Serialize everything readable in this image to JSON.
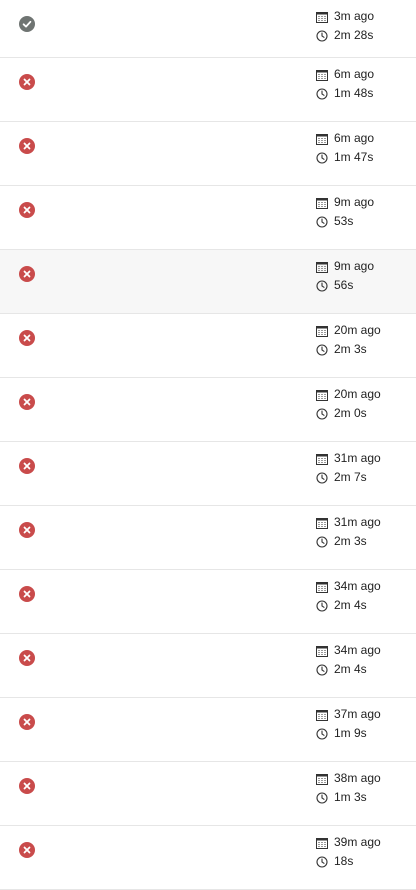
{
  "colors": {
    "success": "#6f7472",
    "failed": "#c94b4b"
  },
  "runs": [
    {
      "status": "success",
      "status_icon": "check-circle-icon",
      "started": "3m ago",
      "duration": "2m 28s"
    },
    {
      "status": "failed",
      "status_icon": "x-circle-icon",
      "started": "6m ago",
      "duration": "1m 48s"
    },
    {
      "status": "failed",
      "status_icon": "x-circle-icon",
      "started": "6m ago",
      "duration": "1m 47s"
    },
    {
      "status": "failed",
      "status_icon": "x-circle-icon",
      "started": "9m ago",
      "duration": "53s"
    },
    {
      "status": "failed",
      "status_icon": "x-circle-icon",
      "started": "9m ago",
      "duration": "56s"
    },
    {
      "status": "failed",
      "status_icon": "x-circle-icon",
      "started": "20m ago",
      "duration": "2m 3s"
    },
    {
      "status": "failed",
      "status_icon": "x-circle-icon",
      "started": "20m ago",
      "duration": "2m 0s"
    },
    {
      "status": "failed",
      "status_icon": "x-circle-icon",
      "started": "31m ago",
      "duration": "2m 7s"
    },
    {
      "status": "failed",
      "status_icon": "x-circle-icon",
      "started": "31m ago",
      "duration": "2m 3s"
    },
    {
      "status": "failed",
      "status_icon": "x-circle-icon",
      "started": "34m ago",
      "duration": "2m 4s"
    },
    {
      "status": "failed",
      "status_icon": "x-circle-icon",
      "started": "34m ago",
      "duration": "2m 4s"
    },
    {
      "status": "failed",
      "status_icon": "x-circle-icon",
      "started": "37m ago",
      "duration": "1m 9s"
    },
    {
      "status": "failed",
      "status_icon": "x-circle-icon",
      "started": "38m ago",
      "duration": "1m 3s"
    },
    {
      "status": "failed",
      "status_icon": "x-circle-icon",
      "started": "39m ago",
      "duration": "18s"
    }
  ]
}
